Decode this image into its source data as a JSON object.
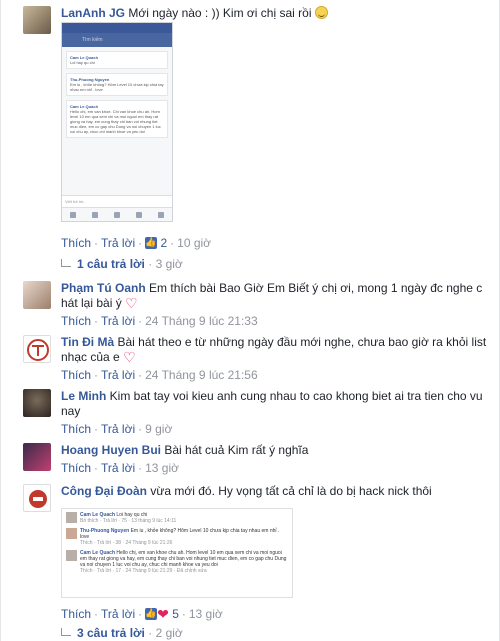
{
  "comments": [
    {
      "name": "LanAnh JG",
      "text": "Mới ngày nào : )) Kim ơi chị sai rồi",
      "like": "Thích",
      "reply": "Trả lời",
      "reactions": "2",
      "time": "10 giờ",
      "replies_label": "1 câu trả lời",
      "replies_time": "3 giờ"
    },
    {
      "name": "Phạm Tú Oanh",
      "text": "Em thích bài Bao Giờ Em Biết ý chị ơi, mong 1 ngày đc nghe c hát lại bài ý",
      "like": "Thích",
      "reply": "Trả lời",
      "time": "24 Tháng 9 lúc 21:33"
    },
    {
      "name": "Tin Đi Mà",
      "text": "Bài hát theo e từ những ngày đầu mới nghe, chưa bao giờ ra khỏi list nhạc của e",
      "like": "Thích",
      "reply": "Trả lời",
      "time": "24 Tháng 9 lúc 21:56"
    },
    {
      "name": "Le Minh",
      "text": "Kim bat tay voi kieu anh cung nhau to cao khong biet ai tra tien cho vu nay",
      "like": "Thích",
      "reply": "Trả lời",
      "time": "9 giờ"
    },
    {
      "name": "Hoang Huyen Bui",
      "text": "Bài hát cuả Kim rất ý nghĩa",
      "like": "Thích",
      "reply": "Trả lời",
      "time": "13 giờ"
    },
    {
      "name": "Công Đại Đoàn",
      "text": "vừa mới đó. Hy vọng tất cả chỉ là do bị hack nick thôi",
      "like": "Thích",
      "reply": "Trả lời",
      "reactions": "5",
      "time": "13 giờ",
      "replies_label": "3 câu trả lời",
      "replies_time": "2 giờ"
    }
  ],
  "phone": {
    "search": "Tìm kiếm",
    "msg1_name": "Cam Le Quach",
    "msg1_text": "Loi hay qu chi",
    "msg2_name": "Thu-Phuong Nguyen",
    "msg2_text": "Em iu , khỏe không? Hôm Level 10 chưa kịp chia tay nhau em nhỉ . love",
    "msg3_name": "Cam Le Quach",
    "msg3_text": "Hello chị, em van khoe. Chi van khoe chu ah. Hom level 10 em qua xem chi va moi nguoi em thay rat giong va hay, em cung thay chi ban voi nhung tiet muc dien, em co gap chu Dung va noi chuyen 1 luc voi chu ay, chuc chi manh khoe va yeu doi",
    "input": "Viết trả lời..."
  },
  "shot": {
    "r1_name": "Cam Le Quach",
    "r1_text": "Loi hay qu chi",
    "r1_meta": "Bỏ thích · Trả lời · 75 · 13 tháng 9 lúc 14:11",
    "r2_name": "Thu-Phuong Nguyen",
    "r2_text": "Em iu , khỏe không? Hôm Level 10 chưa kịp chia tay nhau em nhỉ . love",
    "r2_meta": "Thích · Trả lời · 38 · 24 Tháng 9 lúc 21:26",
    "r3_name": "Cam Le Quach",
    "r3_text": "Hello chị, em van khoe chu ah. Hom level 10 em qua xem chi va moi nguoi em thay rat giong va hay, em cung thay chi ban voi nhung tiet muc dien, em co gap chu Dung va noi chuyen 1 luc voi chu ay, chuc chi manh khoe va yeu doi",
    "r3_meta": "Thích · Trả lời · 17 · 24 Tháng 9 lúc 21:29 · Đã chỉnh sửa"
  },
  "colors": {
    "link": "#365899",
    "meta": "#90949c",
    "heart": "#e0245e",
    "like": "#4267b2"
  }
}
